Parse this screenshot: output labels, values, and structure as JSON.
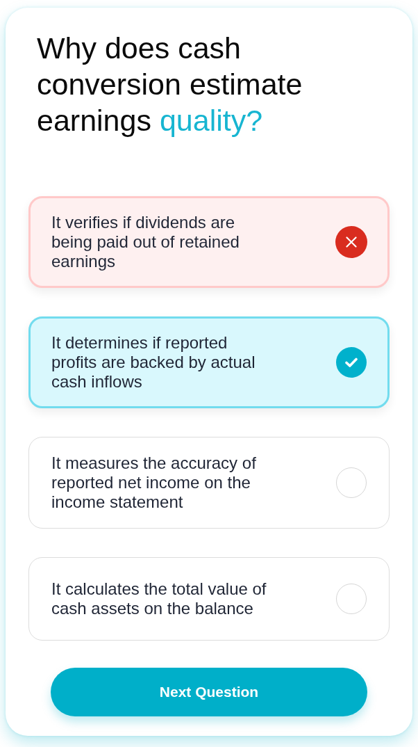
{
  "question": {
    "text": "Why does cash conversion estimate earnings",
    "highlight": "quality?"
  },
  "options": [
    {
      "kind": "wrong",
      "text": "It verifies if dividends are being paid out of retained earnings"
    },
    {
      "kind": "correct",
      "text": "It determines if reported profits are backed by actual cash inflows"
    },
    {
      "kind": "blank",
      "text": "It measures the accuracy of reported net income on the income statement"
    },
    {
      "kind": "blank",
      "text": "It calculates the total value of cash assets on the balance"
    }
  ],
  "next_button": {
    "label": "Next Question"
  }
}
